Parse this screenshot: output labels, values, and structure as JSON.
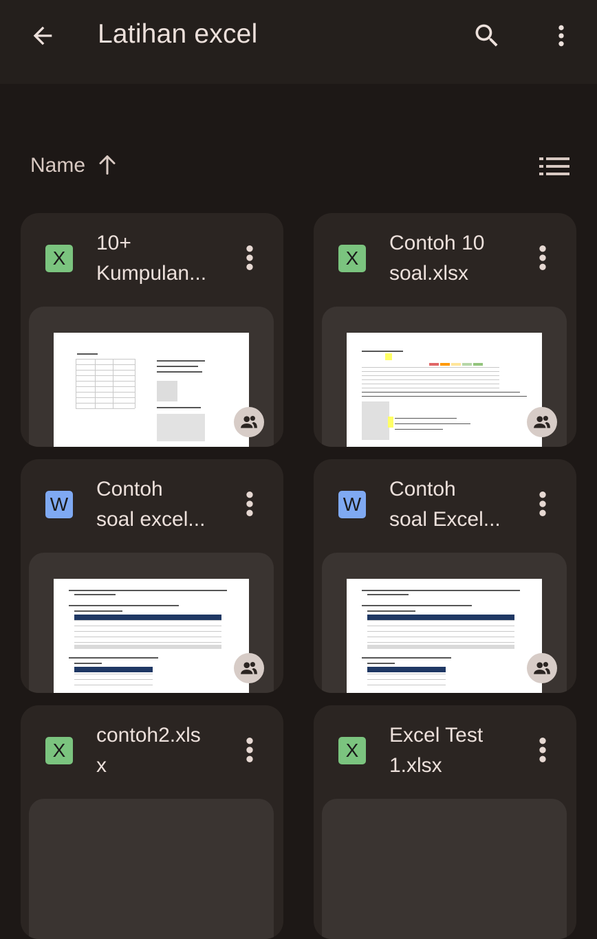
{
  "appbar": {
    "title": "Latihan excel",
    "back_icon": "arrow-back-icon",
    "search_icon": "search-icon",
    "more_icon": "more-vert-icon"
  },
  "sort": {
    "label": "Name",
    "direction_icon": "arrow-up-icon",
    "view_icon": "list-view-icon"
  },
  "files": [
    {
      "name": "10+\nKumpulan...",
      "type_letter": "X",
      "type": "excel",
      "shared": true
    },
    {
      "name": "Contoh 10\nsoal.xlsx",
      "type_letter": "X",
      "type": "excel",
      "shared": true
    },
    {
      "name": "Contoh\nsoal excel...",
      "type_letter": "W",
      "type": "word",
      "shared": true
    },
    {
      "name": "Contoh\nsoal Excel...",
      "type_letter": "W",
      "type": "word",
      "shared": true
    },
    {
      "name": "contoh2.xls\nx",
      "type_letter": "X",
      "type": "excel",
      "shared": false
    },
    {
      "name": "Excel Test\n1.xlsx",
      "type_letter": "X",
      "type": "excel",
      "shared": false
    }
  ],
  "colors": {
    "background": "#1d1816",
    "card": "#2b2522",
    "excel": "#7bc47f",
    "word": "#7fa9f2"
  }
}
